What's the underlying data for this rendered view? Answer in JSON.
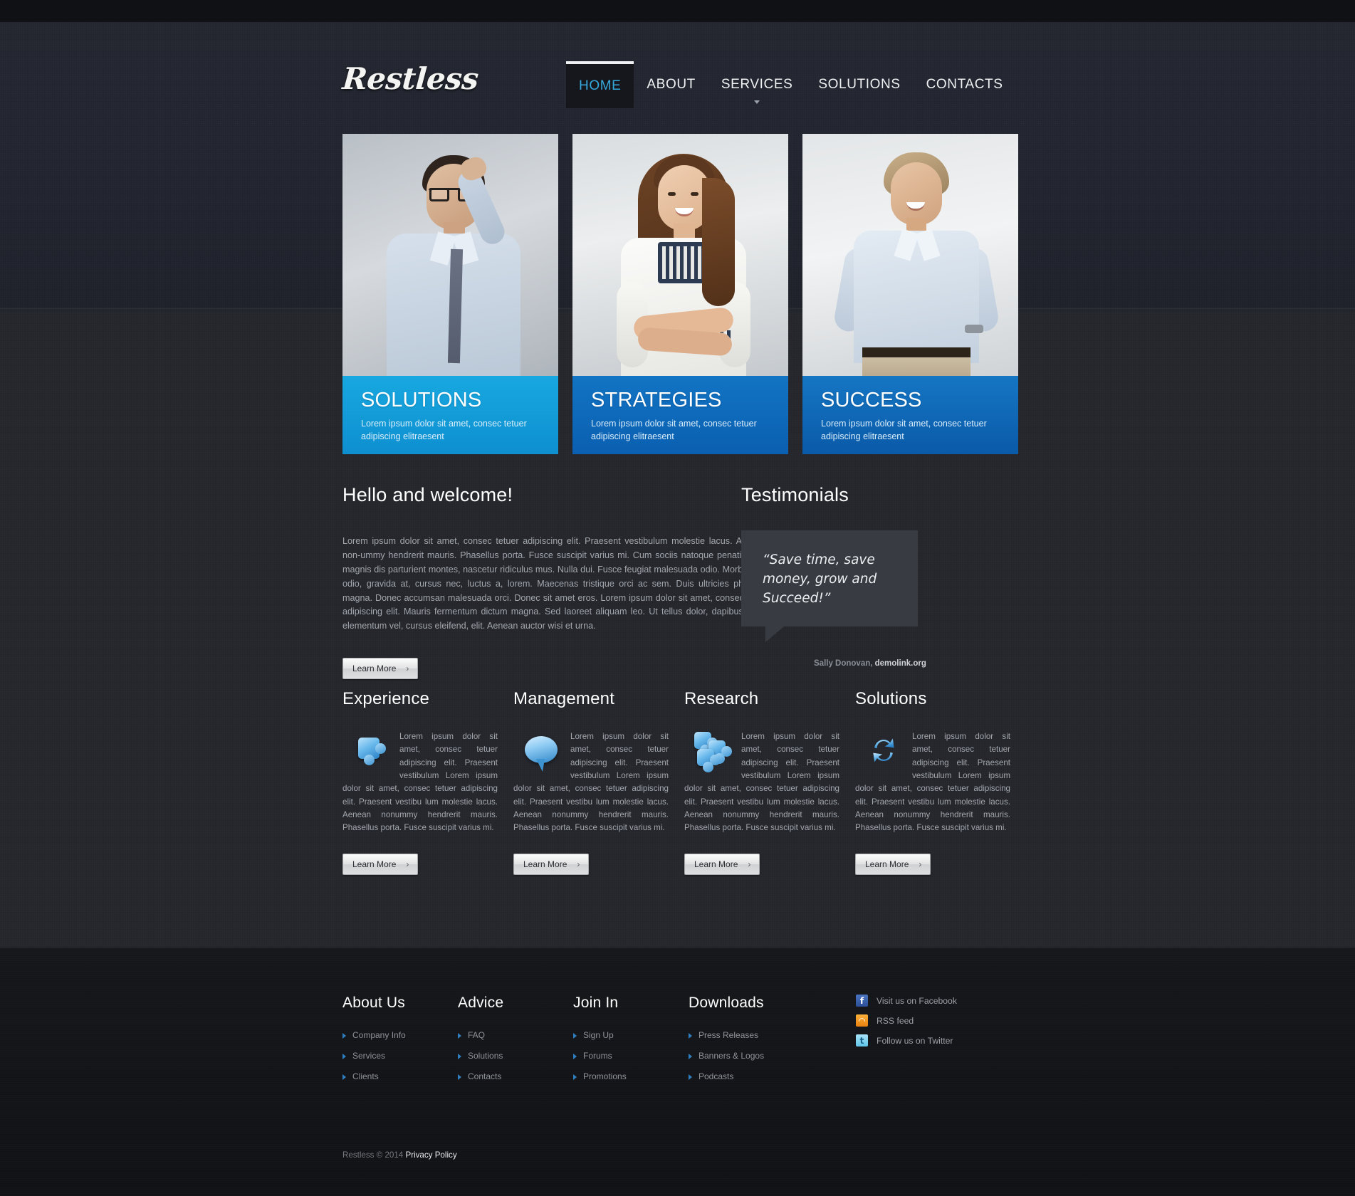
{
  "site": {
    "logo": "Restless"
  },
  "nav": {
    "items": [
      {
        "label": "HOME",
        "active": true,
        "has_sub": false
      },
      {
        "label": "ABOUT",
        "active": false,
        "has_sub": false
      },
      {
        "label": "SERVICES",
        "active": false,
        "has_sub": true
      },
      {
        "label": "SOLUTIONS",
        "active": false,
        "has_sub": false
      },
      {
        "label": "CONTACTS",
        "active": false,
        "has_sub": false
      }
    ]
  },
  "hero": {
    "cards": [
      {
        "title": "SOLUTIONS",
        "text": "Lorem ipsum dolor sit amet, consec tetuer adipiscing elitraesent",
        "color": "#12a0da",
        "photo": "man-with-glasses-hand-on-head"
      },
      {
        "title": "STRATEGIES",
        "text": "Lorem ipsum dolor sit amet, consec tetuer adipiscing elitraesent",
        "color": "#0f6cbd",
        "photo": "smiling-woman-arms-folded"
      },
      {
        "title": "SUCCESS",
        "text": "Lorem ipsum dolor sit amet, consec tetuer adipiscing elitraesent",
        "color": "#0f6cbd",
        "photo": "smiling-man-hands-on-hips"
      }
    ]
  },
  "welcome": {
    "heading": "Hello and welcome!",
    "body": "Lorem ipsum dolor sit amet, consec tetuer adipiscing elit. Praesent vestibulum molestie lacus. Aenean non-ummy hendrerit mauris. Phasellus porta. Fusce suscipit varius mi. Cum sociis natoque penatibus et magnis dis parturient montes, nascetur ridiculus mus. Nulla dui. Fusce feugiat malesuada odio. Morbi nunc odio, gravida at, cursus nec, luctus a, lorem. Maecenas tristique orci ac sem. Duis ultricies pharetra magna. Donec accumsan malesuada orci. Donec sit amet eros. Lorem ipsum dolor sit amet, consectetuer adipiscing elit. Mauris fermentum dictum magna. Sed laoreet aliquam leo. Ut tellus dolor, dapibus eget, elementum vel, cursus eleifend, elit. Aenean auctor wisi et urna.",
    "button": "Learn More",
    "button_chevron": "›"
  },
  "testimonials": {
    "heading": "Testimonials",
    "quote": "“Save time, save money, grow and Succeed!”",
    "author": "Sally Donovan,",
    "site": "demolink.org"
  },
  "features": {
    "button": "Learn More",
    "button_chevron": "›",
    "items": [
      {
        "title": "Experience",
        "icon": "puzzle-piece-icon",
        "text": "Lorem ipsum dolor sit amet, consec tetuer adipiscing elit. Praesent vestibulum Lorem ipsum dolor sit amet, consec tetuer adipiscing elit. Praesent vestibu lum molestie lacus. Aenean nonummy hendrerit mauris. Phasellus porta. Fusce suscipit varius mi."
      },
      {
        "title": "Management",
        "icon": "speech-bubble-icon",
        "text": "Lorem ipsum dolor sit amet, consec tetuer adipiscing elit. Praesent vestibulum Lorem ipsum dolor sit amet, consec tetuer adipiscing elit. Praesent vestibu lum molestie lacus. Aenean nonummy hendrerit mauris. Phasellus porta. Fusce suscipit varius mi."
      },
      {
        "title": "Research",
        "icon": "puzzle-pieces-icon",
        "text": "Lorem ipsum dolor sit amet, consec tetuer adipiscing elit. Praesent vestibulum Lorem ipsum dolor sit amet, consec tetuer adipiscing elit. Praesent vestibu lum molestie lacus. Aenean nonummy hendrerit mauris. Phasellus porta. Fusce suscipit varius mi."
      },
      {
        "title": "Solutions",
        "icon": "refresh-arrows-icon",
        "text": "Lorem ipsum dolor sit amet, consec tetuer adipiscing elit. Praesent vestibulum Lorem ipsum dolor sit amet, consec tetuer adipiscing elit. Praesent vestibu lum molestie lacus. Aenean nonummy hendrerit mauris. Phasellus porta. Fusce suscipit varius mi."
      }
    ]
  },
  "footer": {
    "columns": [
      {
        "title": "About Us",
        "links": [
          "Company Info",
          "Services",
          "Clients"
        ]
      },
      {
        "title": "Advice",
        "links": [
          "FAQ",
          "Solutions",
          "Contacts"
        ]
      },
      {
        "title": "Join In",
        "links": [
          "Sign Up",
          "Forums",
          "Promotions"
        ]
      },
      {
        "title": "Downloads",
        "links": [
          "Press Releases",
          "Banners & Logos",
          "Podcasts"
        ]
      }
    ],
    "social": [
      {
        "label": "Visit us on Facebook",
        "icon": "facebook-icon",
        "glyph": "f",
        "color": "#3a5fa8"
      },
      {
        "label": "RSS feed",
        "icon": "rss-icon",
        "glyph": "◠",
        "color": "#ef8f18"
      },
      {
        "label": "Follow us on Twitter",
        "icon": "twitter-icon",
        "glyph": "t",
        "color": "#6fc8e9"
      }
    ],
    "copyright": "Restless © 2014 ",
    "privacy": "Privacy Policy"
  }
}
